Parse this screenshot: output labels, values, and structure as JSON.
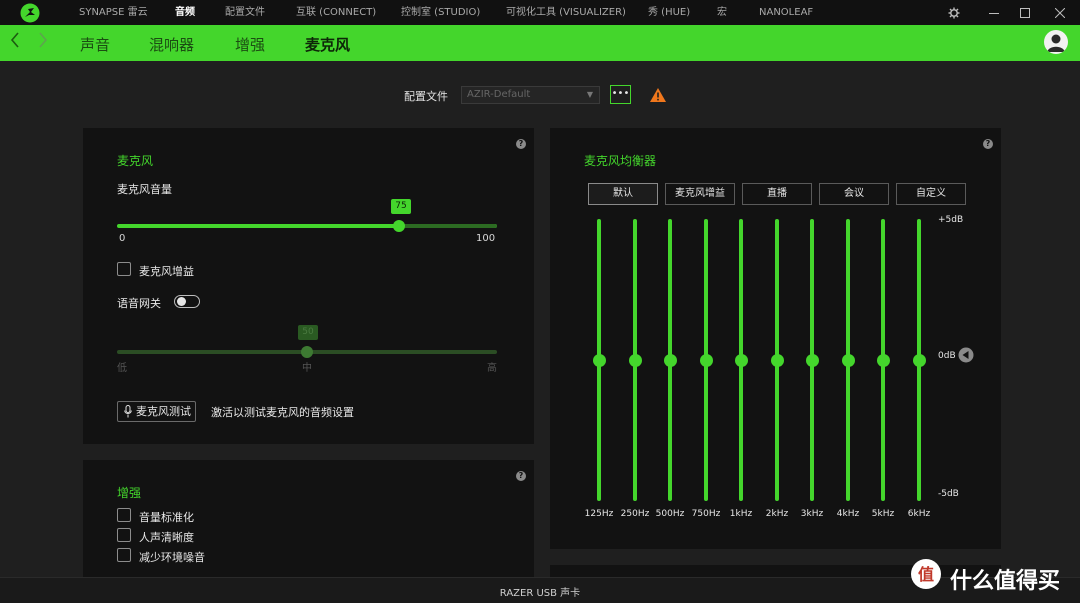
{
  "topnav": {
    "items": [
      "SYNAPSE 雷云",
      "音频",
      "配置文件",
      "互联 (CONNECT)",
      "控制室 (STUDIO)",
      "可视化工具 (VISUALIZER)",
      "秀 (HUE)",
      "宏",
      "NANOLEAF"
    ],
    "active_index": 1
  },
  "subnav": {
    "tabs": [
      "声音",
      "混响器",
      "增强",
      "麦克风"
    ],
    "active_index": 3
  },
  "profile": {
    "label": "配置文件",
    "value": "AZIR-Default",
    "more": "•••"
  },
  "mic_panel": {
    "title": "麦克风",
    "volume_label": "麦克风音量",
    "volume": 75,
    "volume_min": "0",
    "volume_max": "100",
    "gain_label": "麦克风增益",
    "gate_label": "语音网关",
    "gate_value": 50,
    "gate_low": "低",
    "gate_mid": "中",
    "gate_high": "高",
    "test_button": "麦克风测试",
    "test_hint": "激活以测试麦克风的音频设置"
  },
  "enhance_panel": {
    "title": "增强",
    "options": [
      "音量标准化",
      "人声清晰度",
      "减少环境噪音"
    ]
  },
  "eq_panel": {
    "title": "麦克风均衡器",
    "presets": [
      "默认",
      "麦克风增益",
      "直播",
      "会议",
      "自定义"
    ],
    "active_preset": 0,
    "db_top": "+5dB",
    "db_mid": "0dB",
    "db_bottom": "-5dB",
    "bands": [
      {
        "freq": "125Hz",
        "gain_db": 0
      },
      {
        "freq": "250Hz",
        "gain_db": 0
      },
      {
        "freq": "500Hz",
        "gain_db": 0
      },
      {
        "freq": "750Hz",
        "gain_db": 0
      },
      {
        "freq": "1kHz",
        "gain_db": 0
      },
      {
        "freq": "2kHz",
        "gain_db": 0
      },
      {
        "freq": "3kHz",
        "gain_db": 0
      },
      {
        "freq": "4kHz",
        "gain_db": 0
      },
      {
        "freq": "5kHz",
        "gain_db": 0
      },
      {
        "freq": "6kHz",
        "gain_db": 0
      }
    ]
  },
  "footer": {
    "device": "RAZER USB 声卡"
  },
  "watermark": {
    "text": "什么值得买"
  },
  "colors": {
    "accent": "#44d62c",
    "panel": "#121212",
    "background": "#1f1f1f"
  },
  "icons": [
    "razer-logo-icon",
    "gear-icon",
    "minimize-icon",
    "maximize-icon",
    "close-icon",
    "back-arrow-icon",
    "forward-arrow-icon",
    "user-avatar-icon",
    "warning-icon",
    "help-icon",
    "microphone-icon",
    "reset-arrow-icon"
  ]
}
